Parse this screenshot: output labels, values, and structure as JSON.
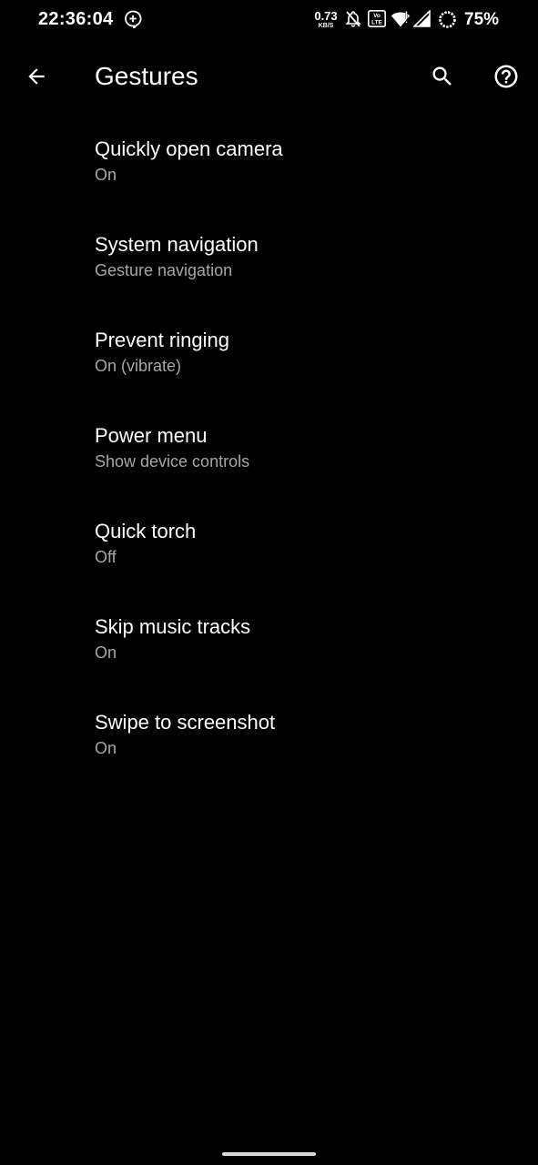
{
  "status_bar": {
    "time": "22:36:04",
    "net_speed_value": "0.73",
    "net_speed_unit": "KB/S",
    "volte_label": "Vo LTE",
    "battery": "75%"
  },
  "app_bar": {
    "title": "Gestures",
    "icons": [
      "back-arrow-icon",
      "search-icon",
      "help-icon"
    ]
  },
  "settings": [
    {
      "title": "Quickly open camera",
      "summary": "On"
    },
    {
      "title": "System navigation",
      "summary": "Gesture navigation"
    },
    {
      "title": "Prevent ringing",
      "summary": "On (vibrate)"
    },
    {
      "title": "Power menu",
      "summary": "Show device controls"
    },
    {
      "title": "Quick torch",
      "summary": "Off"
    },
    {
      "title": "Skip music tracks",
      "summary": "On"
    },
    {
      "title": "Swipe to screenshot",
      "summary": "On"
    }
  ],
  "colors": {
    "background": "#000000",
    "title_text": "#ffffff",
    "summary_text": "#a7a7a7"
  }
}
